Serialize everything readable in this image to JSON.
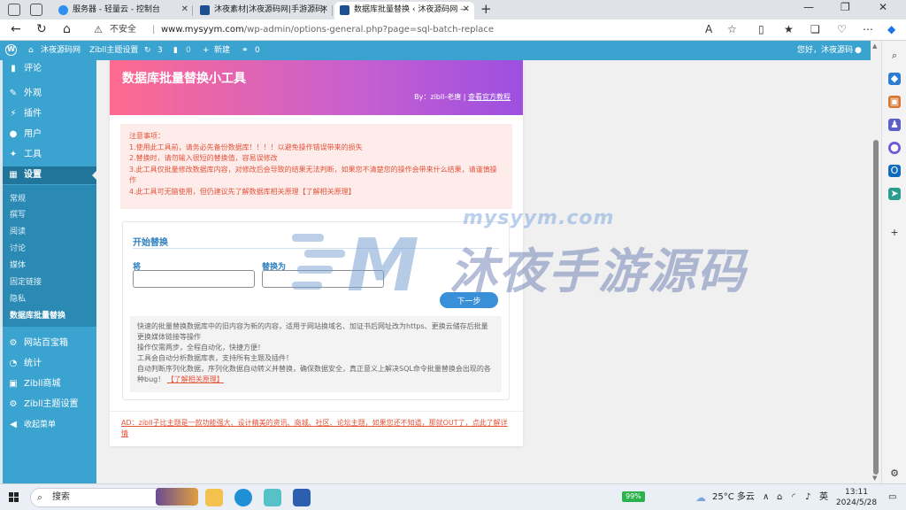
{
  "browser": {
    "tabs": [
      {
        "title": "服务器 - 轻量云 - 控制台",
        "active": false
      },
      {
        "title": "沐夜素材|沐夜源码网|手游源码|",
        "active": false
      },
      {
        "title": "数据库批量替换 ‹ 沐夜源码网 —",
        "active": true
      }
    ],
    "new_tab": "+",
    "address": {
      "warning": "不安全",
      "separator": "|",
      "domain": "www.mysyym.com",
      "path": "/wp-admin/options-general.php?page=sql-batch-replace"
    }
  },
  "adminbar": {
    "site_name": "沐夜源码网",
    "theme_settings": "Zibll主题设置",
    "updates_count": "3",
    "comments_count": "0",
    "new_label": "新建",
    "links_count": "0",
    "greeting": "您好，沐夜源码"
  },
  "sidebar": {
    "top_items": [
      {
        "label": "评论",
        "icon": "comment-icon"
      },
      {
        "label": "外观",
        "icon": "brush-icon"
      },
      {
        "label": "插件",
        "icon": "plugin-icon"
      },
      {
        "label": "用户",
        "icon": "user-icon"
      },
      {
        "label": "工具",
        "icon": "wrench-icon"
      },
      {
        "label": "设置",
        "icon": "settings-icon"
      }
    ],
    "sub_items": [
      {
        "label": "常规"
      },
      {
        "label": "撰写"
      },
      {
        "label": "阅读"
      },
      {
        "label": "讨论"
      },
      {
        "label": "媒体"
      },
      {
        "label": "固定链接"
      },
      {
        "label": "隐私"
      },
      {
        "label": "数据库批量替换"
      }
    ],
    "bottom_items": [
      {
        "label": "网站百宝箱",
        "icon": "gear-icon"
      },
      {
        "label": "统计",
        "icon": "chart-icon"
      },
      {
        "label": "Zibll商城",
        "icon": "shop-icon"
      },
      {
        "label": "Zibll主题设置",
        "icon": "gear-icon"
      },
      {
        "label": "收起菜单",
        "icon": "collapse-icon"
      }
    ]
  },
  "tool": {
    "title": "数据库批量替换小工具",
    "by_prefix": "By：zibll-老唐 |",
    "tutorial_link": "查看官方教程",
    "notice_heading": "注意事项：",
    "notice_items": [
      "1.使用此工具前，请务必先备份数据库！！！！以避免操作错误带来的损失",
      "2.替换时，请勿输入很短的替换值，容易误修改",
      "3.此工具仅批量修改数据库内容，对修改后会导致的结果无法判断，如果您不清楚您的操作会带来什么结果，请谨慎操作",
      "4.此工具可无脑使用，但仍建议先了解数据库相关原理"
    ],
    "notice_link": "【了解相关原理】",
    "step_title": "开始替换",
    "field_old_label": "将",
    "field_new_label": "替换为",
    "field_old_value": "",
    "field_new_value": "",
    "next_button": "下一步",
    "help_lines": [
      "快速的批量替换数据库中的旧内容为新的内容，适用于网站换域名、加证书后网址改为https、更换云储存后批量更换媒体链接等操作",
      "操作仅需两步，全程自动化，快捷方便！",
      "工具会自动分析数据库表，支持所有主题及插件！",
      "自动判断序列化数据，序列化数据自动转义并替换，确保数据安全，真正意义上解决SQL命令批量替换会出现的各种bug！"
    ],
    "help_link": "【了解相关原理】",
    "ad_text": "AD：zibll子比主题是一款功能强大、设计精美的资讯、商城、社区、论坛主题，如果您还不知道，那就OUT了，点此了解详情"
  },
  "watermark": {
    "url": "mysyym.com",
    "text": "沐夜手游源码",
    "logo_text": "M"
  },
  "taskbar": {
    "search_placeholder": "搜索",
    "battery": "99%",
    "weather": "25°C 多云",
    "ime": "英",
    "time": "13:11",
    "date": "2024/5/28"
  }
}
